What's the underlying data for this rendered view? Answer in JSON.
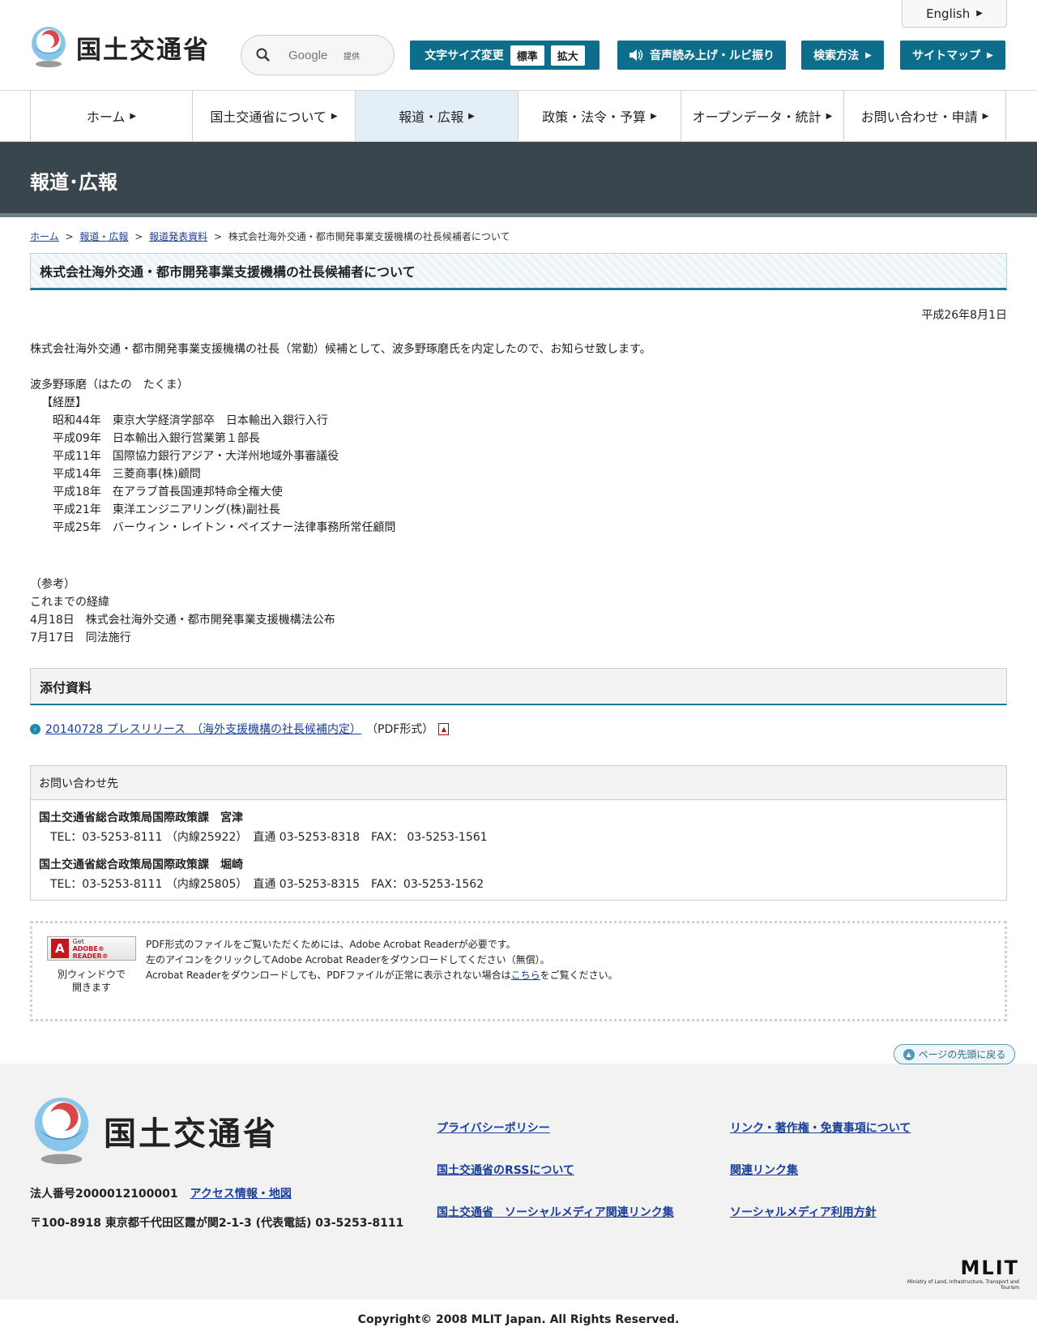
{
  "header": {
    "logo_text": "国土交通省",
    "search_placeholder": "Google",
    "search_powered": "提供",
    "english_label": "English",
    "font_size_label": "文字サイズ変更",
    "font_standard": "標準",
    "font_large": "拡大",
    "audio_label": "音声読み上げ・ルビ振り",
    "search_method_label": "検索方法",
    "sitemap_label": "サイトマップ"
  },
  "nav": {
    "items": [
      {
        "label": "ホーム"
      },
      {
        "label": "国土交通省について"
      },
      {
        "label": "報道・広報"
      },
      {
        "label": "政策・法令・予算"
      },
      {
        "label": "オープンデータ・統計"
      },
      {
        "label": "お問い合わせ・申請"
      }
    ]
  },
  "banner": {
    "title": "報道･広報"
  },
  "breadcrumb": {
    "home": "ホーム",
    "press": "報道・広報",
    "releases": "報道発表資料",
    "current": "株式会社海外交通・都市開発事業支援機構の社長候補者について",
    "sep": ">"
  },
  "article": {
    "title": "株式会社海外交通・都市開発事業支援機構の社長候補者について",
    "date": "平成26年8月1日",
    "intro": "株式会社海外交通・都市開発事業支援機構の社長（常勤）候補として、波多野琢磨氏を内定したので、お知らせ致します。",
    "name": "波多野琢磨（はたの　たくま）",
    "career_label": "【経歴】",
    "career": [
      "昭和44年　東京大学経済学部卒　日本輸出入銀行入行",
      "平成09年　日本輸出入銀行営業第１部長",
      "平成11年　国際協力銀行アジア・大洋州地域外事審議役",
      "平成14年　三菱商事(株)顧問",
      "平成18年　在アラブ首長国連邦特命全権大使",
      "平成21年　東洋エンジニアリング(株)副社長",
      "平成25年　バーウィン・レイトン・ペイズナー法律事務所常任顧問"
    ],
    "ref_label": "（参考）",
    "ref_title": "これまでの経緯",
    "ref_items": [
      "4月18日　株式会社海外交通・都市開発事業支援機構法公布",
      "7月17日　同法施行"
    ]
  },
  "attachments": {
    "heading": "添付資料",
    "items": [
      {
        "link_text": "20140728 プレスリリース　（海外支援機構の社長候補内定）",
        "format": "（PDF形式）"
      }
    ]
  },
  "contact": {
    "heading": "お問い合わせ先",
    "entries": [
      {
        "org": "国土交通省総合政策局国際政策課　宮津",
        "tel": "TEL：03-5253-8111 （内線25922）　直通 03-5253-8318　FAX： 03-5253-1561"
      },
      {
        "org": "国土交通省総合政策局国際政策課　堀崎",
        "tel": "TEL：03-5253-8111 （内線25805）　直通 03-5253-8315　FAX：03-5253-1562"
      }
    ]
  },
  "pdf_note": {
    "badge_get": "Get",
    "badge_name": "ADOBE® READER®",
    "new_window_1": "別ウィンドウで",
    "new_window_2": "開きます",
    "line1": "PDF形式のファイルをご覧いただくためには、Adobe Acrobat Readerが必要です。",
    "line2": "左のアイコンをクリックしてAdobe Acrobat Readerをダウンロードしてください（無償）。",
    "line3_pre": "Acrobat Readerをダウンロードしても、PDFファイルが正常に表示されない場合は",
    "line3_link": "こちら",
    "line3_post": "をご覧ください。"
  },
  "back_to_top": "ページの先頭に戻る",
  "footer": {
    "logo_text": "国土交通省",
    "corp_number": "法人番号2000012100001",
    "access_link": "アクセス情報・地図",
    "address": "〒100-8918 東京都千代田区霞が関2-1-3 (代表電話) 03-5253-8111",
    "links": [
      "プライバシーポリシー",
      "リンク・著作権・免責事項について",
      "国土交通省のRSSについて",
      "関連リンク集",
      "国土交通省　ソーシャルメディア関連リンク集",
      "ソーシャルメディア利用方針"
    ],
    "mlit_logo": "MLIT",
    "mlit_sub": "Ministry of Land, Infrastructure, Transport and Tourism",
    "copyright": "Copyright© 2008 MLIT Japan. All Rights Reserved."
  },
  "colors": {
    "accent": "#0d6e8c",
    "banner": "#39464d",
    "link": "#1a3f99",
    "footer_bg": "#f2f2f2"
  }
}
